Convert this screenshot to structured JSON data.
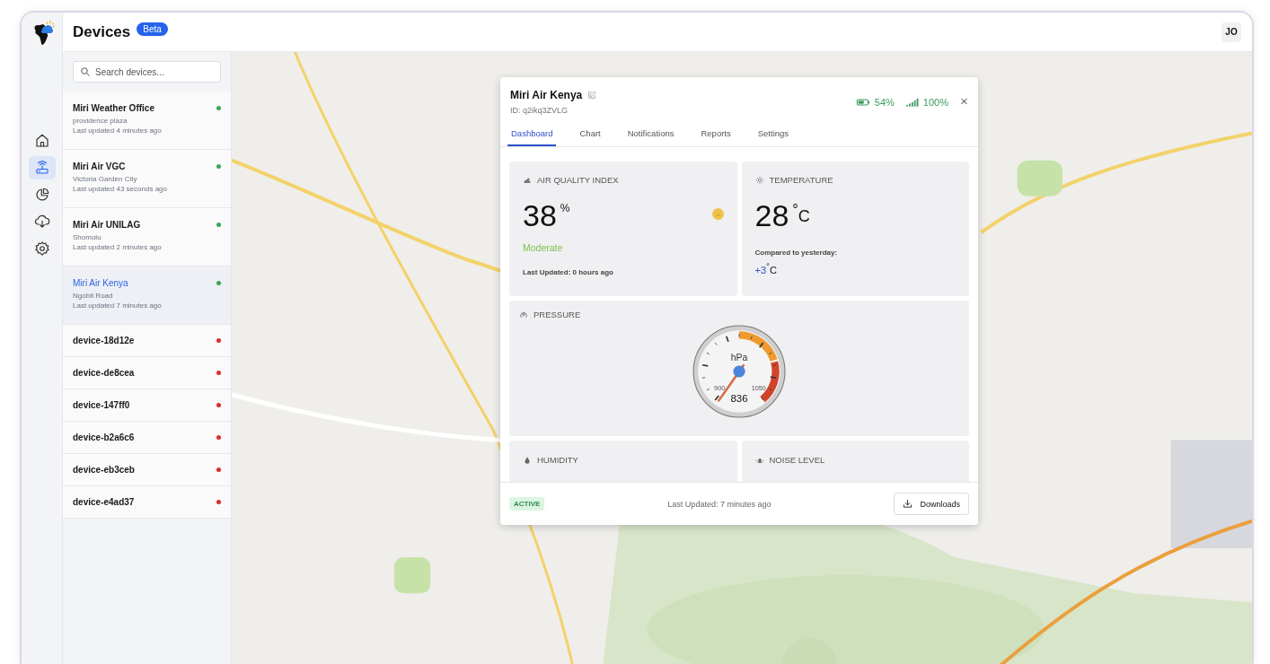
{
  "header": {
    "title": "Devices",
    "badge": "Beta",
    "avatar": "JO"
  },
  "rail": [
    {
      "kind": "home",
      "selected": false
    },
    {
      "kind": "router",
      "selected": true
    },
    {
      "kind": "pie",
      "selected": false
    },
    {
      "kind": "download",
      "selected": false
    },
    {
      "kind": "settings",
      "selected": false
    }
  ],
  "search": {
    "placeholder": "Search devices..."
  },
  "devices": [
    {
      "name": "Miri Weather Office",
      "location": "providence plaza",
      "updated": "Last updated 4 minutes ago",
      "color": "#3aa757",
      "selected": false
    },
    {
      "name": "Miri Air VGC",
      "location": "Victoria Garden City",
      "updated": "Last updated 43 seconds ago",
      "color": "#3aa757",
      "selected": false
    },
    {
      "name": "Miri Air UNILAG",
      "location": "Shomolu",
      "updated": "Last updated 2 minutes ago",
      "color": "#3aa757",
      "selected": false
    },
    {
      "name": "Miri Air Kenya",
      "location": "Ngobit Road",
      "updated": "Last updated 7 minutes ago",
      "color": "#3aa757",
      "selected": true
    },
    {
      "name": "device-18d12e",
      "color": "#e02b2b",
      "selected": false
    },
    {
      "name": "device-de8cea",
      "color": "#e02b2b",
      "selected": false
    },
    {
      "name": "device-147ff0",
      "color": "#e02b2b",
      "selected": false
    },
    {
      "name": "device-b2a6c6",
      "color": "#e02b2b",
      "selected": false
    },
    {
      "name": "device-eb3ceb",
      "color": "#e02b2b",
      "selected": false
    },
    {
      "name": "device-e4ad37",
      "color": "#e02b2b",
      "selected": false
    }
  ],
  "panel": {
    "title": "Miri Air Kenya",
    "id": "ID: q2ikq3ZVLG",
    "battery": "54%",
    "signal": "100%",
    "tabs": [
      {
        "label": "Dashboard",
        "selected": true
      },
      {
        "label": "Chart",
        "selected": false
      },
      {
        "label": "Notifications",
        "selected": false
      },
      {
        "label": "Reports",
        "selected": false
      },
      {
        "label": "Settings",
        "selected": false
      }
    ],
    "aqi": {
      "label": "AIR QUALITY INDEX",
      "value": "38",
      "unit": "%",
      "status": "Moderate",
      "updated": "Last Updated: 0 hours ago"
    },
    "temperature": {
      "label": "TEMPERATURE",
      "value": "28",
      "unit": "$^{°}$C",
      "compare_label": "Compared to yesterday:",
      "delta": "+3",
      "delta_unit": "$^{°}$C"
    },
    "pressure": {
      "label": "PRESSURE",
      "unit": "hPa",
      "min_label": "900",
      "max_label": "1050",
      "reading": "836"
    },
    "humidity": {
      "label": "HUMIDITY"
    },
    "noise": {
      "label": "NOISE LEVEL"
    },
    "footer": {
      "status": "ACTIVE",
      "updated": "Last Updated: 7 minutes ago",
      "button": "Downloads"
    }
  }
}
